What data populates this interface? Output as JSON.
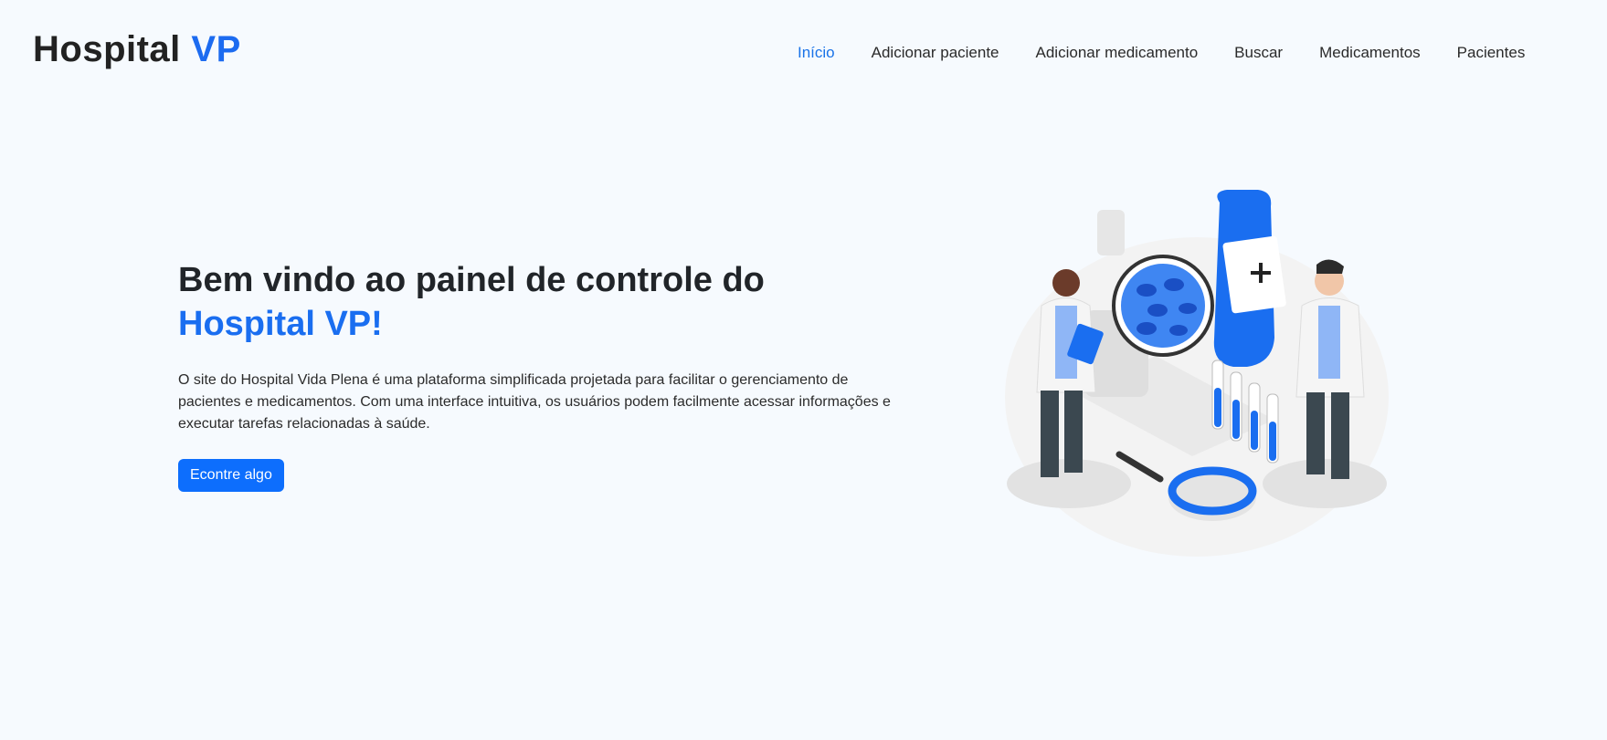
{
  "brand": {
    "name": "Hospital",
    "accent": "VP"
  },
  "nav": {
    "items": [
      {
        "label": "Início",
        "active": true
      },
      {
        "label": "Adicionar paciente",
        "active": false
      },
      {
        "label": "Adicionar medicamento",
        "active": false
      },
      {
        "label": "Buscar",
        "active": false
      },
      {
        "label": "Medicamentos",
        "active": false
      },
      {
        "label": "Pacientes",
        "active": false
      }
    ]
  },
  "hero": {
    "title": "Bem vindo ao painel de controle do",
    "title_accent": "Hospital VP!",
    "description": "O site do Hospital Vida Plena é uma plataforma simplificada projetada para facilitar o gerenciamento de pacientes e medicamentos. Com uma interface intuitiva, os usuários podem facilmente acessar informações e executar tarefas relacionadas à saúde.",
    "cta_label": "Econtre algo"
  },
  "colors": {
    "accent": "#1a6ef0",
    "button": "#0d6efd",
    "background": "#f6fafe",
    "text": "#212529"
  },
  "illustration": {
    "icon": "medical-lab-illustration"
  }
}
